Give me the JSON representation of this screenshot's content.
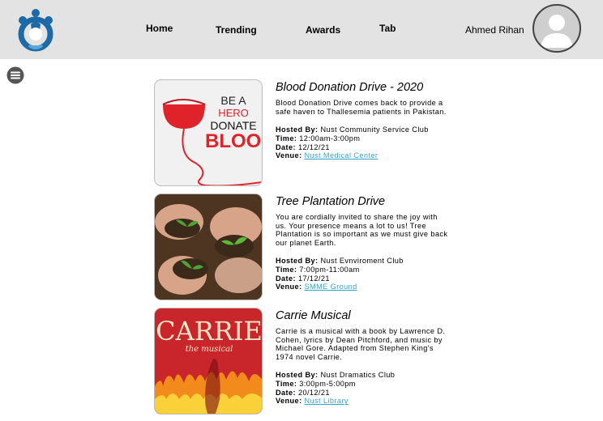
{
  "header": {
    "nav": [
      "Home",
      "Trending",
      "Awards",
      "Tab"
    ],
    "user_name": "Ahmed Rihan"
  },
  "labels": {
    "hosted_by": "Hosted By:",
    "time": "Time:",
    "date": "Date:",
    "venue": "Venue:"
  },
  "events": [
    {
      "title": "Blood Donation Drive - 2020",
      "description": "Blood Donation Drive comes back to provide a safe haven to Thallesemia patients in Pakistan.",
      "hosted_by": "Nust Community Service Club",
      "time": "12:00am-3:00pm",
      "date": "12/12/21",
      "venue": "Nust Medical Center",
      "poster_text": [
        "BE A",
        "HERO",
        "DONATE",
        "BLOOD"
      ]
    },
    {
      "title": "Tree Plantation Drive",
      "description": "You are cordially invited to share the joy with us. Your presence means a lot to us! Tree Plantation is so important as we must give back our planet Earth.",
      "hosted_by": "Nust Evnviroment Club",
      "time": "7:00pm-11:00am",
      "date": "17/12/21",
      "venue": "SMME Ground"
    },
    {
      "title": "Carrie Musical",
      "description": "Carrie is a musical with a book by Lawrence D. Cohen, lyrics by Dean Pitchford, and music by Michael Gore. Adapted from Stephen King's 1974 novel Carrie.",
      "hosted_by": "Nust Dramatics Club",
      "time": "3:00pm-5:00pm",
      "date": "20/12/21",
      "venue": "Nust Library",
      "poster_text": [
        "CARRIE",
        "the musical"
      ]
    }
  ],
  "colors": {
    "topbar": "#e3e3e3",
    "logo": "#1e6aa8",
    "link": "#36a6c8",
    "blood": "#e0232b"
  }
}
